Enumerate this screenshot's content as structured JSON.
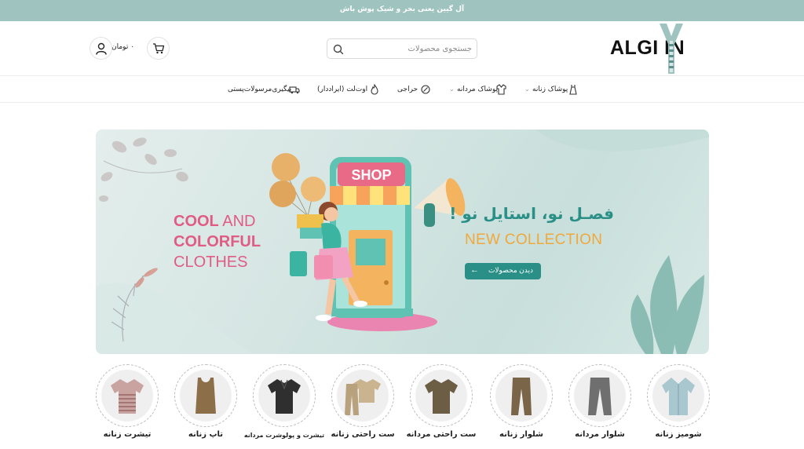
{
  "topbar": {
    "text": "آل گیین یعنی بخر و شیک پوش باش"
  },
  "header": {
    "logo_text": "ALGI IN",
    "search": {
      "placeholder": "جستجوی محصولات",
      "icon": "search-icon"
    },
    "cart": {
      "icon": "cart-icon",
      "total": "۰ تومان"
    },
    "account": {
      "icon": "user-icon"
    }
  },
  "nav": {
    "items": [
      {
        "label": "پوشاک زنانه",
        "icon": "dress-icon",
        "has_dropdown": true
      },
      {
        "label": "پوشاک مردانه",
        "icon": "shirt-icon",
        "has_dropdown": true
      },
      {
        "label": "حراجی",
        "icon": "discount-icon",
        "has_dropdown": false
      },
      {
        "label": "اوت‌لت (ایراددار)",
        "icon": "flame-icon",
        "has_dropdown": false
      },
      {
        "label": "پیگیری‌مرسولات‌پستی",
        "icon": "truck-icon",
        "has_dropdown": false
      }
    ]
  },
  "banner": {
    "en_line1_bold": "COOL",
    "en_line1_light": " AND",
    "en_line2": "COLORFUL",
    "en_line3": "CLOTHES",
    "shop_sign": "SHOP",
    "fa_title": "فصـل نو، استایل نو !",
    "collection": "NEW COLLECTION",
    "cta": "دیدن محصولات",
    "colors": {
      "pink": "#e05c85",
      "teal": "#2a8f86",
      "orange": "#f0a83a"
    }
  },
  "categories": [
    {
      "label": "شومیز زنانه",
      "icon": "blouse-icon",
      "color": "#a9c7cf"
    },
    {
      "label": "شلوار مردانه",
      "icon": "pants-icon",
      "color": "#6f6f6f"
    },
    {
      "label": "شلوار زنانه",
      "icon": "pants-icon",
      "color": "#7a6548"
    },
    {
      "label": "ست راحتی مردانه",
      "icon": "tshirt-icon",
      "color": "#6b5e45"
    },
    {
      "label": "ست راحتی زنانه",
      "icon": "set-icon",
      "color": "#b8a27d"
    },
    {
      "label": "تیشرت و پولوشرت مردانه",
      "icon": "polo-icon",
      "color": "#2f2f2f"
    },
    {
      "label": "تاپ زنانه",
      "icon": "tank-icon",
      "color": "#8c6f48"
    },
    {
      "label": "تیشرت زنانه",
      "icon": "tshirt-icon",
      "color": "#a86f6f"
    }
  ]
}
